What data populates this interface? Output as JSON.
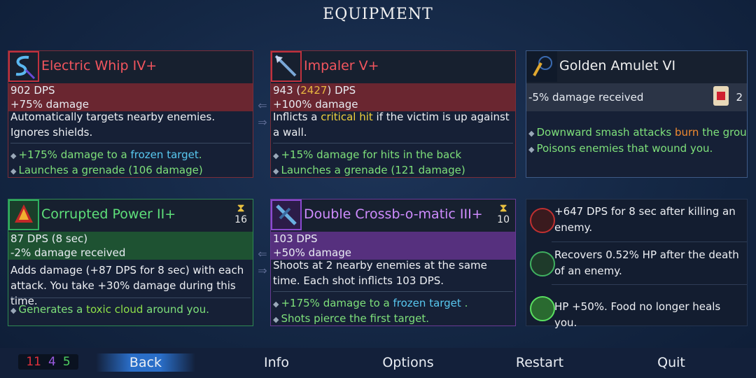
{
  "title": "EQUIPMENT",
  "cards": {
    "whip": {
      "name": "Electric Whip IV+",
      "dps": "902 DPS",
      "bonus": "+75% damage",
      "desc": "Automatically targets nearby enemies. Ignores shields.",
      "perk1_a": "+175% damage to a ",
      "perk1_b": "frozen target",
      "perk1_c": ".",
      "perk2": "Launches a grenade (106 damage)"
    },
    "impaler": {
      "name": "Impaler V+",
      "dps_a": "943 (",
      "dps_b": "2427",
      "dps_c": ") DPS",
      "bonus": "+100% damage",
      "desc_a": "Inflicts a ",
      "desc_b": "critical hit",
      "desc_c": " if the victim is up against a wall.",
      "perk1": "+15% damage for hits in the back",
      "perk2": "Launches a grenade (121 damage)"
    },
    "amulet": {
      "name": "Golden Amulet VI",
      "stat": "-5% damage received",
      "scroll_count": "2",
      "perk1_a": "Downward smash attacks ",
      "perk1_b": "burn",
      "perk1_c": " the ground.",
      "perk2": "Poisons enemies that wound you."
    },
    "corrupted": {
      "name": "Corrupted Power II+",
      "timer": "16",
      "dps": "87 DPS (8 sec)",
      "bonus": "-2% damage received",
      "desc": "Adds damage (+87 DPS for 8 sec) with each attack. You take +30% damage during this time.",
      "perk1_a": "Generates a ",
      "perk1_b": "toxic cloud",
      "perk1_c": " around you."
    },
    "crossbow": {
      "name": "Double Crossb-o-matic III+",
      "timer": "10",
      "dps": "103 DPS",
      "bonus": "+50% damage",
      "desc": "Shoots at 2 nearby enemies at the same time. Each shot inflicts 103 DPS.",
      "perk1_a": "+175% damage to a ",
      "perk1_b": "frozen target",
      "perk1_c": " .",
      "perk2": "Shots pierce the first target."
    }
  },
  "mutations": [
    {
      "icon": "bow-kill-mutation-icon",
      "text": "+647 DPS for 8 sec after killing an enemy."
    },
    {
      "icon": "skull-heal-mutation-icon",
      "text": "Recovers 0.52% HP after the death of an enemy."
    },
    {
      "icon": "green-heart-mutation-icon",
      "text": "HP +50%. Food no longer heals you."
    }
  ],
  "scrolls": {
    "brutality": "11",
    "tactics": "4",
    "survival": "5"
  },
  "nav": {
    "back": "Back",
    "info": "Info",
    "options": "Options",
    "restart": "Restart",
    "quit": "Quit"
  },
  "colors": {
    "brutality": "#e0303c",
    "tactics": "#9a5ae0",
    "survival": "#4ed060"
  }
}
